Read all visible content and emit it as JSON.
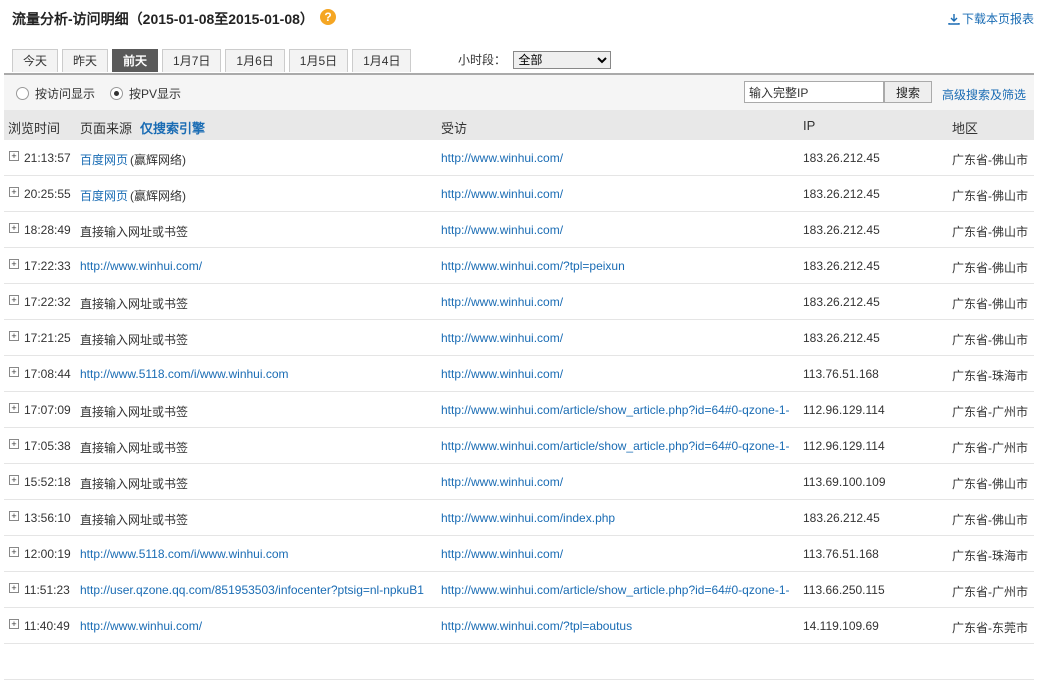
{
  "header": {
    "title": "流量分析-访问明细（2015-01-08至2015-01-08）",
    "help_icon": "?",
    "download_label": "下载本页报表"
  },
  "tabs": [
    "今天",
    "昨天",
    "前天",
    "1月7日",
    "1月6日",
    "1月5日",
    "1月4日"
  ],
  "active_tab": "前天",
  "period": {
    "label": "小时段：",
    "selected": "全部"
  },
  "toolbar": {
    "radio_visit": "按访问显示",
    "radio_pv": "按PV显示",
    "selected": "按PV显示",
    "search_placeholder": "输入完整IP",
    "search_button": "搜索",
    "advanced_link": "高级搜索及筛选"
  },
  "columns": {
    "time": "浏览时间",
    "source": "页面来源",
    "source_filter": "仅搜索引擎",
    "page": "受访",
    "ip": "IP",
    "area": "地区"
  },
  "rows": [
    {
      "time": "21:13:57",
      "source_link": "百度网页",
      "source_note": "(赢辉网络)",
      "page": "http://www.winhui.com/",
      "ip": "183.26.212.45",
      "area": "广东省-佛山市"
    },
    {
      "time": "20:25:55",
      "source_link": "百度网页",
      "source_note": "(赢辉网络)",
      "page": "http://www.winhui.com/",
      "ip": "183.26.212.45",
      "area": "广东省-佛山市"
    },
    {
      "time": "18:28:49",
      "source_text": "直接输入网址或书签",
      "page": "http://www.winhui.com/",
      "ip": "183.26.212.45",
      "area": "广东省-佛山市"
    },
    {
      "time": "17:22:33",
      "source_link": "http://www.winhui.com/",
      "page": "http://www.winhui.com/?tpl=peixun",
      "ip": "183.26.212.45",
      "area": "广东省-佛山市"
    },
    {
      "time": "17:22:32",
      "source_text": "直接输入网址或书签",
      "page": "http://www.winhui.com/",
      "ip": "183.26.212.45",
      "area": "广东省-佛山市"
    },
    {
      "time": "17:21:25",
      "source_text": "直接输入网址或书签",
      "page": "http://www.winhui.com/",
      "ip": "183.26.212.45",
      "area": "广东省-佛山市"
    },
    {
      "time": "17:08:44",
      "source_link": "http://www.5118.com/i/www.winhui.com",
      "page": "http://www.winhui.com/",
      "ip": "113.76.51.168",
      "area": "广东省-珠海市"
    },
    {
      "time": "17:07:09",
      "source_text": "直接输入网址或书签",
      "page": "http://www.winhui.com/article/show_article.php?id=64#0-qzone-1-",
      "ip": "112.96.129.114",
      "area": "广东省-广州市"
    },
    {
      "time": "17:05:38",
      "source_text": "直接输入网址或书签",
      "page": "http://www.winhui.com/article/show_article.php?id=64#0-qzone-1-",
      "ip": "112.96.129.114",
      "area": "广东省-广州市"
    },
    {
      "time": "15:52:18",
      "source_text": "直接输入网址或书签",
      "page": "http://www.winhui.com/",
      "ip": "113.69.100.109",
      "area": "广东省-佛山市"
    },
    {
      "time": "13:56:10",
      "source_text": "直接输入网址或书签",
      "page": "http://www.winhui.com/index.php",
      "ip": "183.26.212.45",
      "area": "广东省-佛山市"
    },
    {
      "time": "12:00:19",
      "source_link": "http://www.5118.com/i/www.winhui.com",
      "page": "http://www.winhui.com/",
      "ip": "113.76.51.168",
      "area": "广东省-珠海市"
    },
    {
      "time": "11:51:23",
      "source_link": "http://user.qzone.qq.com/851953503/infocenter?ptsig=nl-npkuB1",
      "page": "http://www.winhui.com/article/show_article.php?id=64#0-qzone-1-",
      "ip": "113.66.250.115",
      "area": "广东省-广州市"
    },
    {
      "time": "11:40:49",
      "source_link": "http://www.winhui.com/",
      "page": "http://www.winhui.com/?tpl=aboutus",
      "ip": "14.119.109.69",
      "area": "广东省-东莞市"
    },
    {
      "time": "",
      "source_text": "",
      "page": "",
      "ip": "",
      "area": ""
    }
  ],
  "colors": {
    "accent": "#1a6cb4",
    "help": "#f5a623",
    "active_tab": "#5a5a5a"
  }
}
